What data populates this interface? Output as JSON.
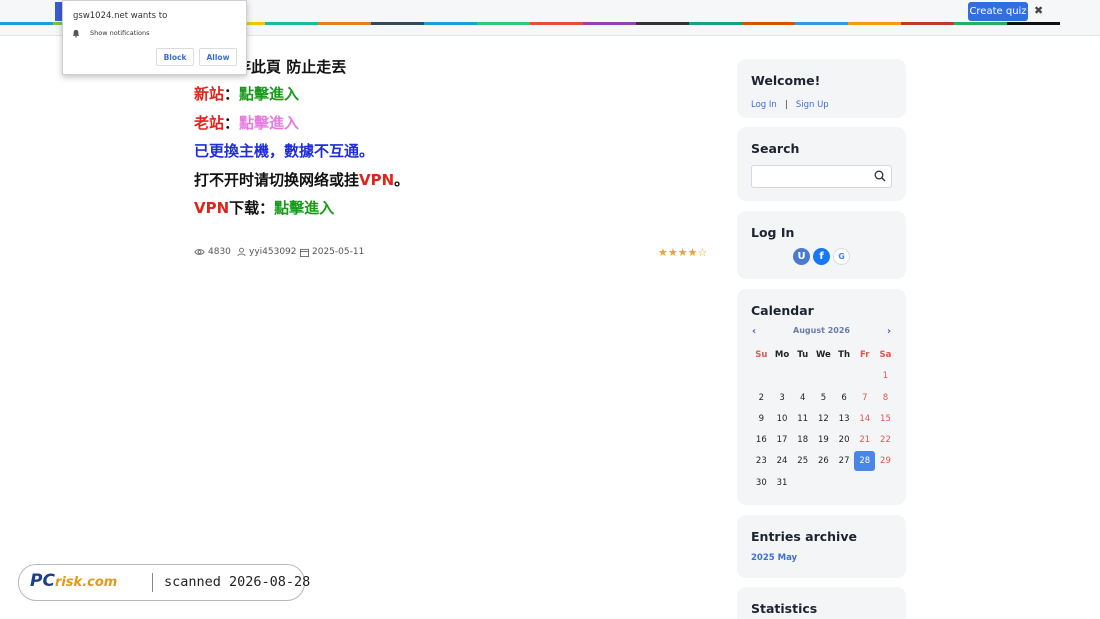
{
  "topbar": {
    "create_quiz_label": "Create quiz",
    "close_glyph": "✖",
    "rainbow_colors": [
      "#1c9fd9",
      "#7fc24a",
      "#e94c3d",
      "#9b59b6",
      "#f1c40f",
      "#1abc9c",
      "#e67e22",
      "#34495e",
      "#1c9fd9",
      "#2ecc71",
      "#e74c3c",
      "#8e44ad",
      "#333333",
      "#16a085",
      "#d35400",
      "#3498db",
      "#f39c12",
      "#c0392b",
      "#27ae60",
      "#111111"
    ]
  },
  "notification": {
    "title": "gsw1024.net wants to",
    "permission_text": "Show notifications",
    "block_label": "Block",
    "allow_label": "Allow"
  },
  "content": {
    "line1_partial": "存此頁 防止走丟",
    "line2_label": "新站",
    "line2_colon": "：",
    "line2_link": "點擊進入",
    "line3_label": "老站",
    "line3_colon": "：",
    "line3_link": "點擊進入",
    "line4": "已更換主機，數據不互通。",
    "line5_pre": "打不开时请切换网络或挂",
    "line5_vpn": "VPN",
    "line5_post": "。",
    "line6_vpn": "VPN",
    "line6_text": "下载：",
    "line6_link": "點擊進入"
  },
  "meta": {
    "views": "4830",
    "author": "yyi453092",
    "date": "2025-05-11",
    "rating": 4,
    "rating_max": 5
  },
  "sidebar": {
    "welcome_title": "Welcome!",
    "login_link": "Log In",
    "separator": "|",
    "signup_link": "Sign Up",
    "search_title": "Search",
    "search_value": "",
    "login_title": "Log In",
    "social_u": "U",
    "social_f": "f",
    "social_g": "G",
    "calendar_title": "Calendar",
    "calendar_month": "August 2026",
    "calendar_prev": "‹",
    "calendar_next": "›",
    "weekdays": [
      "Su",
      "Mo",
      "Tu",
      "We",
      "Th",
      "Fr",
      "Sa"
    ],
    "calendar_rows": [
      [
        "",
        "",
        "",
        "",
        "",
        "",
        "1"
      ],
      [
        "2",
        "3",
        "4",
        "5",
        "6",
        "7",
        "8"
      ],
      [
        "9",
        "10",
        "11",
        "12",
        "13",
        "14",
        "15"
      ],
      [
        "16",
        "17",
        "18",
        "19",
        "20",
        "21",
        "22"
      ],
      [
        "23",
        "24",
        "25",
        "26",
        "27",
        "28",
        "29"
      ],
      [
        "30",
        "31",
        "",
        "",
        "",
        "",
        ""
      ]
    ],
    "calendar_today": "28",
    "archive_title": "Entries archive",
    "archive_link": "2025 May",
    "stats_title": "Statistics"
  },
  "watermark": {
    "logo_pc": "PC",
    "logo_risk": "risk.com",
    "scanned_text": "scanned 2026-08-28"
  }
}
